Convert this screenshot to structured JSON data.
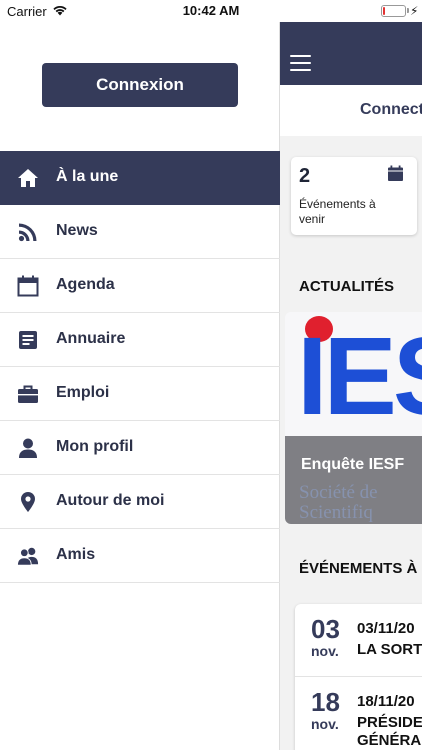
{
  "status_bar": {
    "carrier": "Carrier",
    "time": "10:42 AM",
    "battery_level": 0.1,
    "battery_color": "#e33333"
  },
  "drawer": {
    "login_label": "Connexion",
    "items": [
      {
        "label": "À la une",
        "icon": "home-icon",
        "active": true
      },
      {
        "label": "News",
        "icon": "rss-icon",
        "active": false
      },
      {
        "label": "Agenda",
        "icon": "calendar-icon",
        "active": false
      },
      {
        "label": "Annuaire",
        "icon": "directory-icon",
        "active": false
      },
      {
        "label": "Emploi",
        "icon": "briefcase-icon",
        "active": false
      },
      {
        "label": "Mon profil",
        "icon": "person-icon",
        "active": false
      },
      {
        "label": "Autour de moi",
        "icon": "location-pin-icon",
        "active": false
      },
      {
        "label": "Amis",
        "icon": "friends-icon",
        "active": false
      }
    ]
  },
  "main": {
    "connect_label": "Connect",
    "events_card": {
      "count": "2",
      "label": "Événements à venir"
    },
    "news_heading": "ACTUALITÉS",
    "news": [
      {
        "title": "Enquête IESF",
        "logo_text": "IES",
        "sub1": "Société de",
        "sub2": "Scientifiq"
      }
    ],
    "events_heading": "ÉVÉNEMENTS À",
    "events": [
      {
        "day": "03",
        "month": "nov.",
        "date": "03/11/20",
        "title": "LA SORT"
      },
      {
        "day": "18",
        "month": "nov.",
        "date": "18/11/20",
        "title": "PRÉSIDE",
        "title2": "GÉNÉRA"
      }
    ]
  },
  "colors": {
    "primary": "#353b5a",
    "background": "#f2f2f2",
    "logo_red": "#e0202e",
    "logo_blue": "#1d4fd6"
  }
}
